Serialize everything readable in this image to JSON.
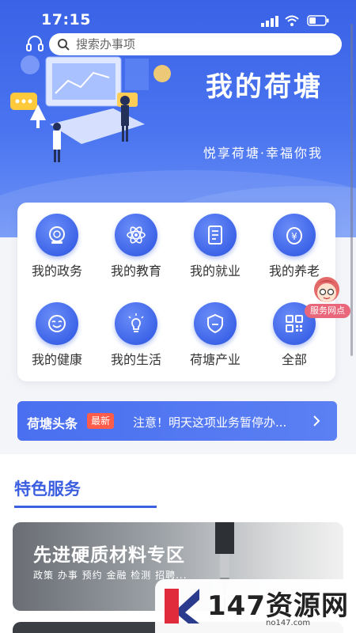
{
  "status_bar": {
    "time": "17:15"
  },
  "search": {
    "placeholder": "搜索办事项"
  },
  "hero": {
    "title": "我的荷塘",
    "slogan": "悦享荷塘·幸福你我"
  },
  "services": [
    {
      "label": "我的政务",
      "icon": "government-seal-icon"
    },
    {
      "label": "我的教育",
      "icon": "atom-icon"
    },
    {
      "label": "我的就业",
      "icon": "document-icon"
    },
    {
      "label": "我的养老",
      "icon": "yuan-coin-icon"
    },
    {
      "label": "我的健康",
      "icon": "smile-health-icon"
    },
    {
      "label": "我的生活",
      "icon": "lightbulb-icon"
    },
    {
      "label": "荷塘产业",
      "icon": "shield-icon"
    },
    {
      "label": "全部",
      "icon": "grid-apps-icon"
    }
  ],
  "float_widget": {
    "label": "服务网点"
  },
  "news": {
    "title": "荷塘头条",
    "badge": "最新",
    "text": "注意！明天这项业务暂停办..."
  },
  "features": {
    "section_title": "特色服务",
    "card_title": "先进硬质材料专区",
    "card_subtitle": "政策 办事 预约 金融 检测 招聘..."
  },
  "watermark": {
    "text": "147资源网",
    "url": "no147.com"
  },
  "colors": {
    "primary": "#3b5fe0",
    "badge_red": "#ff5d4a"
  }
}
